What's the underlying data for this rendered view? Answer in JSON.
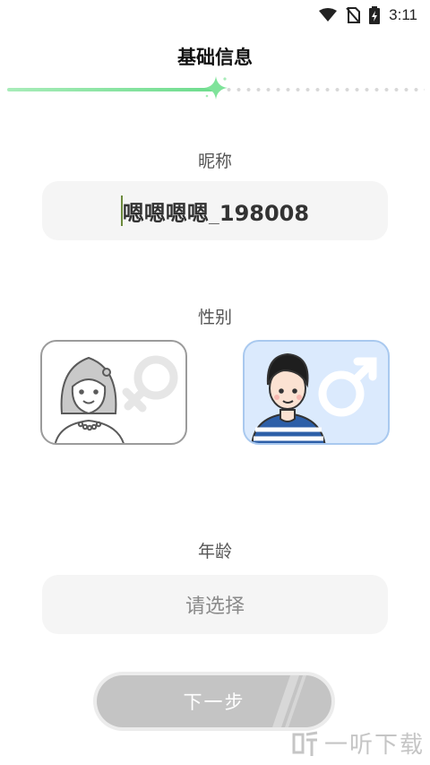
{
  "status_bar": {
    "time": "3:11",
    "icons": [
      "wifi-icon",
      "no-sim-icon",
      "battery-charging-icon"
    ]
  },
  "header": {
    "title": "基础信息"
  },
  "progress": {
    "value": 0.5
  },
  "nickname": {
    "label": "昵称",
    "value": "嗯嗯嗯嗯_198008"
  },
  "gender": {
    "label": "性别",
    "options": [
      {
        "id": "female",
        "icon": "female-symbol-icon",
        "selected": false
      },
      {
        "id": "male",
        "icon": "male-symbol-icon",
        "selected": true
      }
    ]
  },
  "age": {
    "label": "年龄",
    "placeholder": "请选择"
  },
  "next_button": {
    "label": "下一步"
  },
  "watermark": {
    "text": "一听下载"
  },
  "colors": {
    "progress_accent": "#6ddc8d",
    "male_card_bg": "#dbeafd",
    "male_card_border": "#a9c9ef",
    "button_bg": "#c4c4c4"
  }
}
